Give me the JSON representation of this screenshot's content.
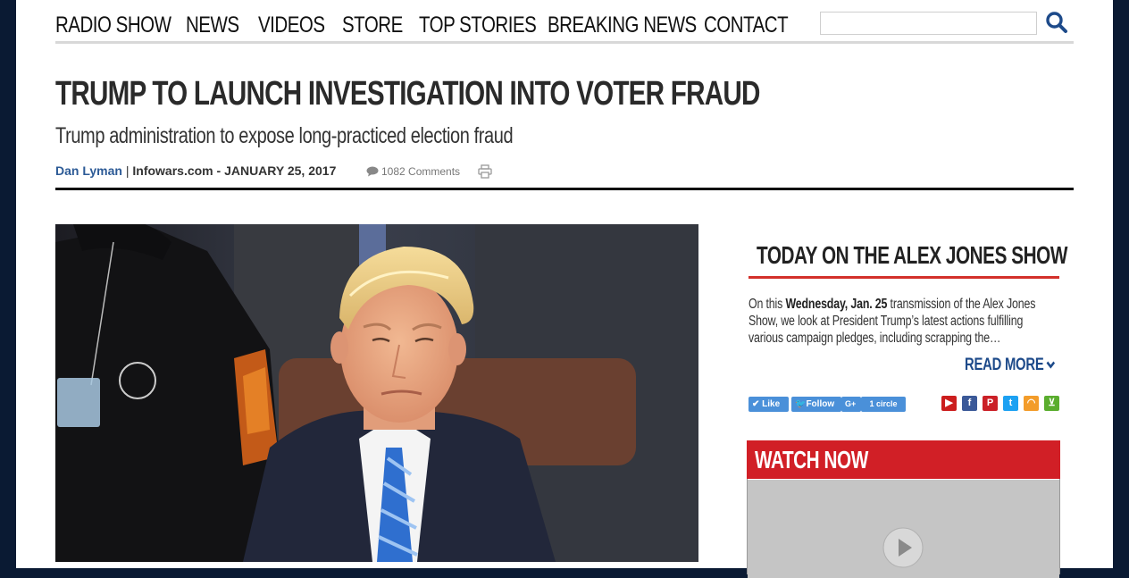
{
  "nav": {
    "items": [
      "RADIO SHOW",
      "NEWS",
      "VIDEOS",
      "STORE",
      "TOP STORIES",
      "BREAKING NEWS",
      "CONTACT"
    ],
    "search_placeholder": ""
  },
  "article": {
    "headline": "TRUMP TO LAUNCH INVESTIGATION INTO VOTER FRAUD",
    "subheadline": "Trump administration to expose long-practiced election fraud",
    "author": "Dan Lyman",
    "separator": "|",
    "site": "Infowars.com",
    "date": "- JANUARY 25, 2017",
    "comments": "1082 Comments"
  },
  "sidebar": {
    "today_title": "TODAY ON THE ALEX JONES SHOW",
    "desc_prefix": "On this ",
    "desc_bold": "Wednesday, Jan. 25",
    "desc_suffix": " transmission of the Alex Jones Show, we look at President Trump’s latest actions fulfilling various campaign pledges, including scrapping the…",
    "read_more": "READ MORE",
    "social": {
      "like": "Like",
      "follow": "Follow",
      "gplus": "G+",
      "circle": "1 circle"
    },
    "watch_now": "WATCH NOW"
  },
  "colors": {
    "accent_red": "#d11f26",
    "link_blue": "#2c5a96",
    "social_blue": "#4a90d9"
  }
}
